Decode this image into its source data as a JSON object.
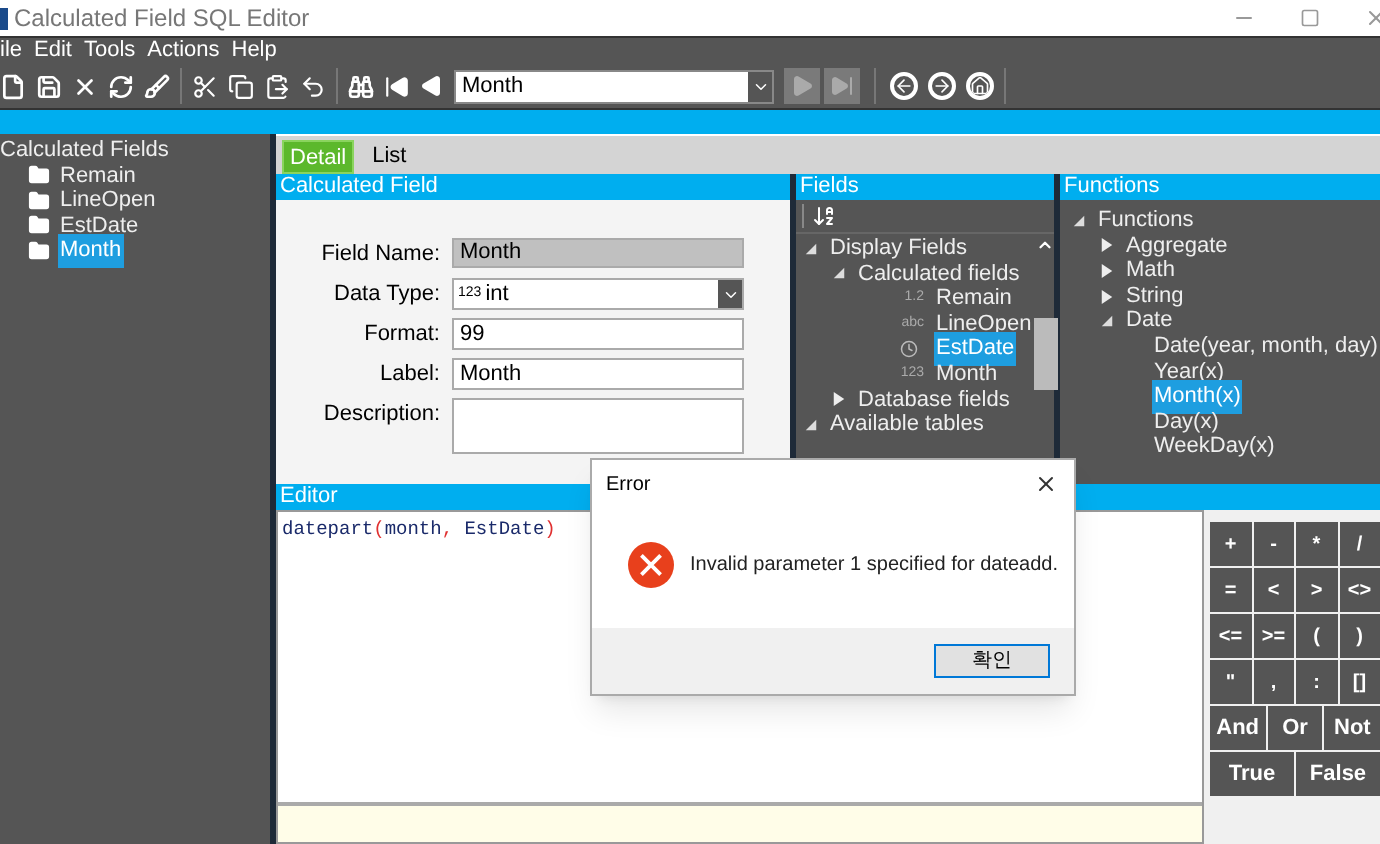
{
  "window": {
    "title": "Calculated Field SQL Editor"
  },
  "menu": [
    "ile",
    "Edit",
    "Tools",
    "Actions",
    "Help"
  ],
  "toolbar": {
    "combo_value": "Month",
    "nav_buttons": [
      {
        "kind": "next",
        "disabled": true
      },
      {
        "kind": "last",
        "disabled": true
      }
    ]
  },
  "left_tree": {
    "label": "Calculated Fields",
    "children": [
      {
        "label": "Remain",
        "selected": false
      },
      {
        "label": "LineOpen",
        "selected": false
      },
      {
        "label": "EstDate",
        "selected": false
      },
      {
        "label": "Month",
        "selected": true
      }
    ]
  },
  "tabs": [
    {
      "label": "Detail",
      "selected": true
    },
    {
      "label": "List",
      "selected": false
    }
  ],
  "calculated_field": {
    "title": "Calculated Field",
    "fields": [
      {
        "kind": "readonly",
        "label": "Field Name:",
        "value": "Month"
      },
      {
        "kind": "dropdown",
        "label": "Data Type:",
        "type_label": "123",
        "value": "int"
      },
      {
        "kind": "text",
        "label": "Format:",
        "value": "99"
      },
      {
        "kind": "text",
        "label": "Label:",
        "value": "Month"
      },
      {
        "kind": "multiline",
        "label": "Description:"
      }
    ]
  },
  "fields_panel": {
    "title": "Fields",
    "tree": [
      {
        "label": "Display Fields",
        "expanded": true,
        "children": [
          {
            "label": "Calculated fields",
            "expanded": true,
            "children": [
              {
                "label": "Remain",
                "kind": "typed",
                "type_label": "1.2",
                "selected": false
              },
              {
                "label": "LineOpen",
                "kind": "typed",
                "type_label": "abc",
                "selected": false
              },
              {
                "label": "EstDate",
                "kind": "date",
                "selected": true
              },
              {
                "label": "Month",
                "kind": "typed",
                "type_label": "123",
                "selected": false
              }
            ]
          },
          {
            "label": "Database fields",
            "expanded": false
          }
        ]
      },
      {
        "label": "Available tables",
        "expanded": true
      }
    ]
  },
  "functions_panel": {
    "title": "Functions",
    "tree": [
      {
        "label": "Functions",
        "expanded": true,
        "children": [
          {
            "label": "Aggregate",
            "expanded": false
          },
          {
            "label": "Math",
            "expanded": false
          },
          {
            "label": "String",
            "expanded": false
          },
          {
            "label": "Date",
            "expanded": true,
            "children": [
              {
                "label": "Date(year, month, day)",
                "selected": false
              },
              {
                "label": "Year(x)",
                "selected": false
              },
              {
                "label": "Month(x)",
                "selected": true
              },
              {
                "label": "Day(x)",
                "selected": false
              },
              {
                "label": "WeekDay(x)",
                "selected": false
              }
            ]
          }
        ]
      }
    ]
  },
  "editor": {
    "title": "Editor",
    "code": [
      {
        "text": "datepart",
        "kind": "word"
      },
      {
        "text": "(",
        "kind": "punct"
      },
      {
        "text": "month",
        "kind": "word"
      },
      {
        "text": ",",
        "kind": "punct"
      },
      {
        "text": " EstDate",
        "kind": "word"
      },
      {
        "text": ")",
        "kind": "punct"
      }
    ]
  },
  "keypad": [
    [
      "+",
      "-",
      "*",
      "/"
    ],
    [
      "=",
      "<",
      ">",
      "<>"
    ],
    [
      "<=",
      ">=",
      "(",
      ")"
    ],
    [
      "\"",
      ",",
      ":",
      "[]"
    ],
    [
      "And",
      "Or",
      "Not"
    ],
    [
      "True",
      "False"
    ]
  ],
  "dialog": {
    "title": "Error",
    "message": "Invalid parameter 1 specified for dateadd.",
    "button": "확인"
  }
}
